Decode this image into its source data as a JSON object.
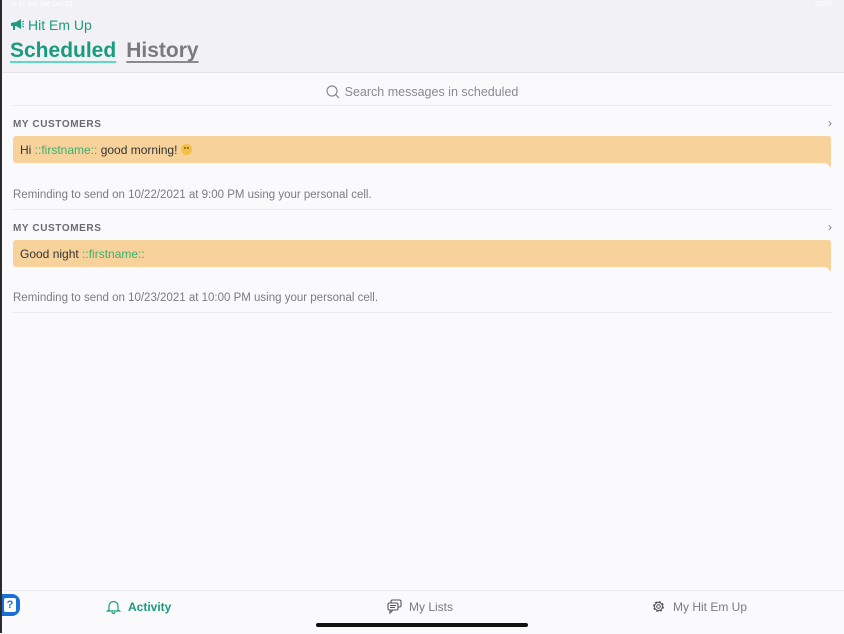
{
  "status_bar": {
    "time": "9:41 AM  Sat Oct 23",
    "right": "100%"
  },
  "header": {
    "app_name": "Hit Em Up",
    "tabs": [
      {
        "label": "Scheduled",
        "active": true
      },
      {
        "label": "History",
        "active": false
      }
    ]
  },
  "search": {
    "placeholder": "Search messages in scheduled"
  },
  "messages": [
    {
      "group": "MY CUSTOMERS",
      "text_before": "Hi ",
      "variable": "::firstname::",
      "text_after": " good morning!",
      "emoji": "slightly-smiling-face",
      "reminder": "Reminding to send on 10/22/2021 at 9:00 PM using your personal cell."
    },
    {
      "group": "MY CUSTOMERS",
      "text_before": "Good night ",
      "variable": "::firstname::",
      "text_after": "",
      "reminder": "Reminding to send on 10/23/2021 at 10:00 PM using your personal cell."
    }
  ],
  "tabbar": {
    "items": [
      {
        "label": "Activity",
        "icon": "bell-icon",
        "active": true
      },
      {
        "label": "My Lists",
        "icon": "chat-bubbles-icon",
        "active": false
      },
      {
        "label": "My Hit Em Up",
        "icon": "gear-icon",
        "active": false
      }
    ]
  },
  "help": {
    "label": "?"
  },
  "colors": {
    "accent": "#1a9b7d",
    "bubble": "#f8d29b",
    "variable": "#3fae6c",
    "help": "#1a6fd8"
  }
}
